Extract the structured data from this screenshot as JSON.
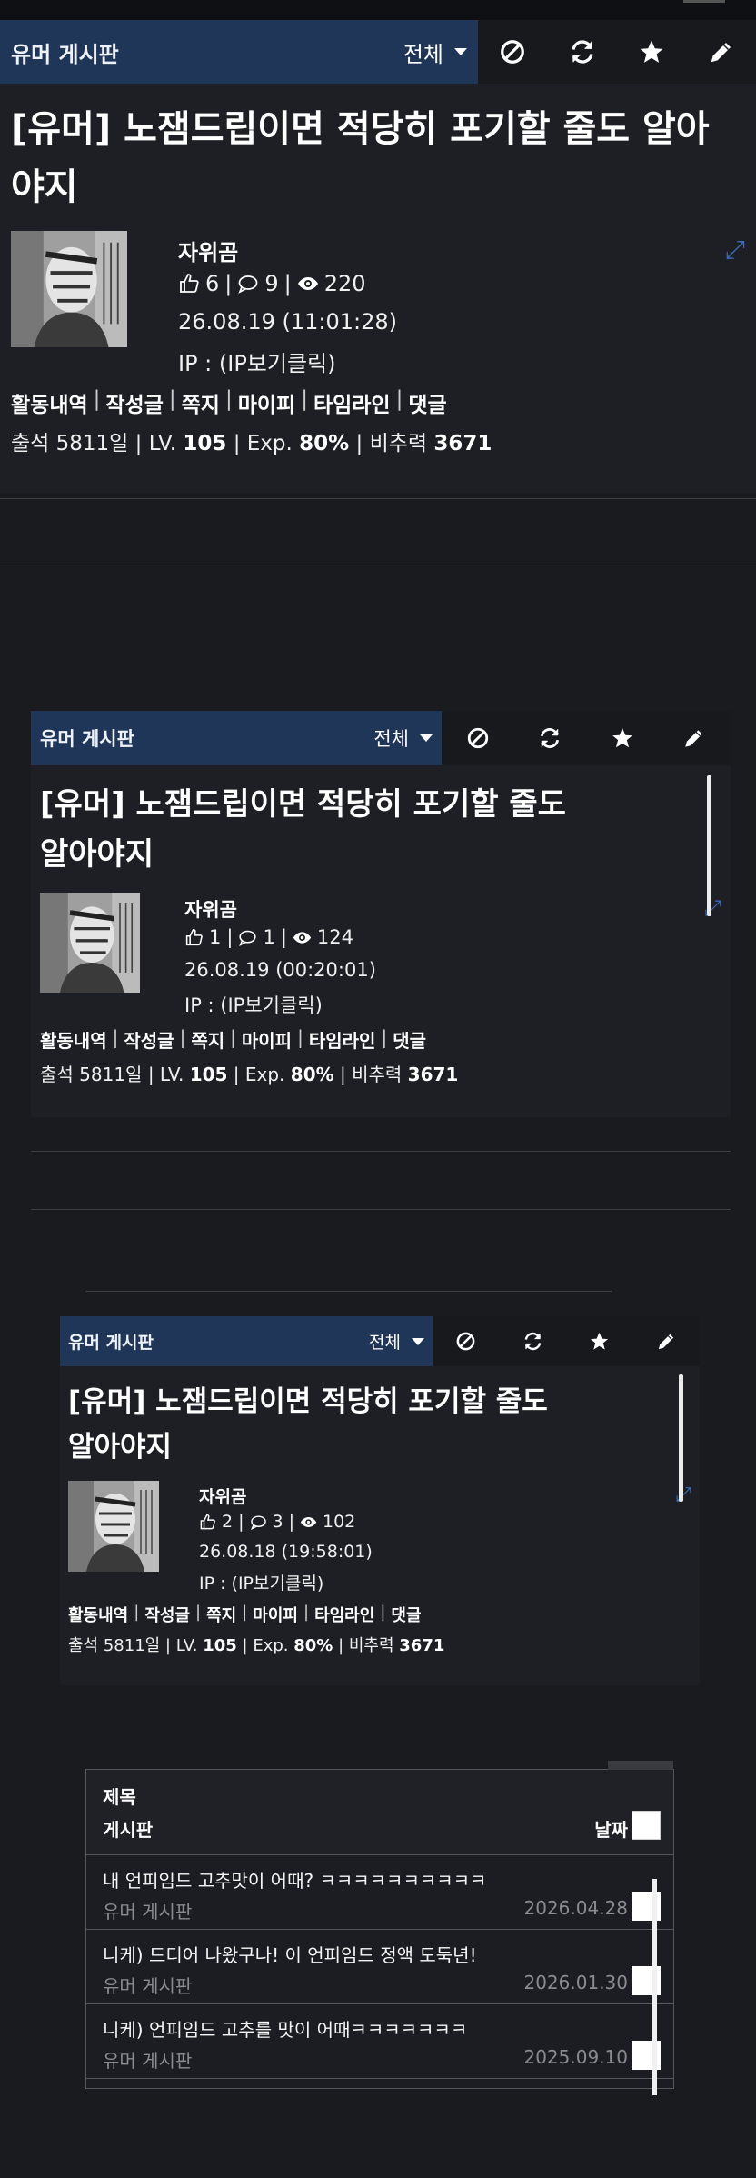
{
  "posts": [
    {
      "board": "유머 게시판",
      "filter": "전체",
      "title": "[유머] 노잼드립이면 적당히 포기할 줄도 알아야지",
      "author": "자위곰",
      "likes": "6",
      "comments": "9",
      "views": "220",
      "datetime": "26.08.19 (11:01:28)",
      "ip": "IP : (IP보기클릭)",
      "links": [
        "활동내역",
        "작성글",
        "쪽지",
        "마이피",
        "타임라인",
        "댓글"
      ],
      "attendance": "출석 5811일 |",
      "lv_label": "LV.",
      "lv": "105",
      "exp_label": "| Exp.",
      "exp": "80%",
      "ratio_label": "| 비추력",
      "ratio": "3671"
    },
    {
      "board": "유머 게시판",
      "filter": "전체",
      "title": "[유머] 노잼드립이면 적당히 포기할 줄도 알아야지",
      "author": "자위곰",
      "likes": "1",
      "comments": "1",
      "views": "124",
      "datetime": "26.08.19 (00:20:01)",
      "ip": "IP : (IP보기클릭)",
      "links": [
        "활동내역",
        "작성글",
        "쪽지",
        "마이피",
        "타임라인",
        "댓글"
      ],
      "attendance": "출석 5811일 |",
      "lv_label": "LV.",
      "lv": "105",
      "exp_label": "| Exp.",
      "exp": "80%",
      "ratio_label": "| 비추력",
      "ratio": "3671"
    },
    {
      "board": "유머 게시판",
      "filter": "전체",
      "title": "[유머] 노잼드립이면 적당히 포기할 줄도 알아야지",
      "author": "자위곰",
      "likes": "2",
      "comments": "3",
      "views": "102",
      "datetime": "26.08.18 (19:58:01)",
      "ip": "IP : (IP보기클릭)",
      "links": [
        "활동내역",
        "작성글",
        "쪽지",
        "마이피",
        "타임라인",
        "댓글"
      ],
      "attendance": "출석 5811일 |",
      "lv_label": "LV.",
      "lv": "105",
      "exp_label": "| Exp.",
      "exp": "80%",
      "ratio_label": "| 비추력",
      "ratio": "3671"
    }
  ],
  "list": {
    "header_title": "제목",
    "header_board": "게시판",
    "header_date": "날짜",
    "rows": [
      {
        "title": "내 언피임드 고추맛이 어때? ㅋㅋㅋㅋㅋㅋㅋㅋㅋㅋ",
        "board": "유머 게시판",
        "date": "2026.04.28"
      },
      {
        "title": "니케) 드디어 나왔구나! 이 언피임드 정액 도둑년!",
        "board": "유머 게시판",
        "date": "2026.01.30"
      },
      {
        "title": "니케) 언피임드 고추를 맛이 어때ㅋㅋㅋㅋㅋㅋㅋ",
        "board": "유머 게시판",
        "date": "2025.09.10"
      }
    ]
  },
  "icons": [
    "block-icon",
    "refresh-icon",
    "star-icon",
    "pencil-icon",
    "thumbs-up-icon",
    "comment-icon",
    "eye-icon",
    "expand-icon"
  ],
  "colors": {
    "board_bg": "#1f3659",
    "expand": "#3b6bb8",
    "page_bg": "#1a1b1f"
  }
}
